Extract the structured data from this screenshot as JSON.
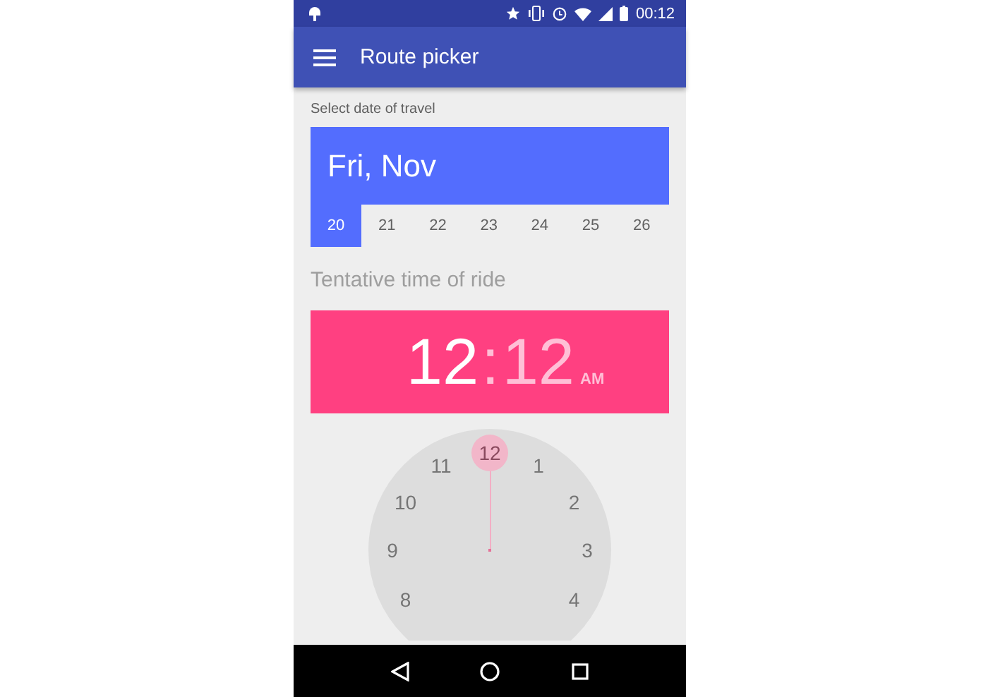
{
  "status_bar": {
    "time": "00:12"
  },
  "app_bar": {
    "title": "Route picker"
  },
  "date_picker": {
    "label": "Select date of travel",
    "header": "Fri, Nov",
    "days": [
      {
        "label": "20",
        "selected": true
      },
      {
        "label": "21",
        "selected": false
      },
      {
        "label": "22",
        "selected": false
      },
      {
        "label": "23",
        "selected": false
      },
      {
        "label": "24",
        "selected": false
      },
      {
        "label": "25",
        "selected": false
      },
      {
        "label": "26",
        "selected": false
      }
    ]
  },
  "time_picker": {
    "label": "Tentative time of ride",
    "hour": {
      "text": "12",
      "selected": true
    },
    "separator": ":",
    "minute": {
      "text": "12",
      "selected": false
    },
    "period": "AM",
    "dial": [
      {
        "label": "12",
        "selected": true
      },
      {
        "label": "11",
        "selected": false
      },
      {
        "label": "1",
        "selected": false
      },
      {
        "label": "10",
        "selected": false
      },
      {
        "label": "2",
        "selected": false
      },
      {
        "label": "9",
        "selected": false
      },
      {
        "label": "3",
        "selected": false
      },
      {
        "label": "8",
        "selected": false
      },
      {
        "label": "4",
        "selected": false
      }
    ]
  }
}
